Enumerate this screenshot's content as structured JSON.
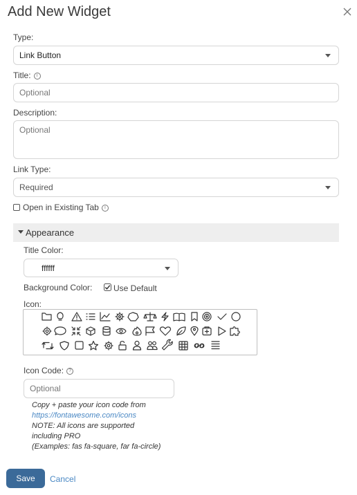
{
  "dialog": {
    "title": "Add New Widget",
    "close_icon": "close-icon"
  },
  "type": {
    "label": "Type:",
    "value": "Link Button"
  },
  "title_field": {
    "label": "Title:",
    "placeholder": "Optional"
  },
  "description": {
    "label": "Description:",
    "placeholder": "Optional"
  },
  "link_type": {
    "label": "Link Type:",
    "value": "Required"
  },
  "open_existing": {
    "label": "Open in Existing Tab",
    "checked": false
  },
  "appearance": {
    "header": "Appearance",
    "title_color": {
      "label": "Title Color:",
      "value": "ffffff"
    },
    "background_color": {
      "label": "Background Color:",
      "use_default_label": "Use Default",
      "checked": true
    },
    "icon": {
      "label": "Icon:",
      "icons": [
        "folder-icon",
        "lightbulb-icon",
        "warning-icon",
        "list-icon",
        "chart-line-icon",
        "gear-icon",
        "circle-outline-icon",
        "scale-icon",
        "bolt-icon",
        "book-icon",
        "bookmark-icon",
        "target-icon",
        "check-icon",
        "circle-icon",
        "settings-icon",
        "comment-icon",
        "compress-icon",
        "cube-icon",
        "database-icon",
        "eye-icon",
        "fire-icon",
        "flag-icon",
        "heart-icon",
        "leaf-icon",
        "map-pin-icon",
        "first-aid-icon",
        "play-icon",
        "puzzle-icon",
        "retweet-icon",
        "shield-icon",
        "square-icon",
        "star-icon",
        "cog-icon",
        "unlock-icon",
        "user-icon",
        "users-icon",
        "wrench-icon",
        "table-icon",
        "link-icon",
        "align-justify-icon"
      ]
    },
    "icon_code": {
      "label": "Icon Code:",
      "placeholder": "Optional",
      "help_line1": "Copy + paste your icon code from",
      "help_link": "https://fontawesome.com/icons",
      "help_line2": "NOTE: All icons are supported",
      "help_line3": "including PRO",
      "help_line4": "(Examples: fas fa-square, far fa-circle)"
    }
  },
  "footer": {
    "save": "Save",
    "cancel": "Cancel"
  }
}
